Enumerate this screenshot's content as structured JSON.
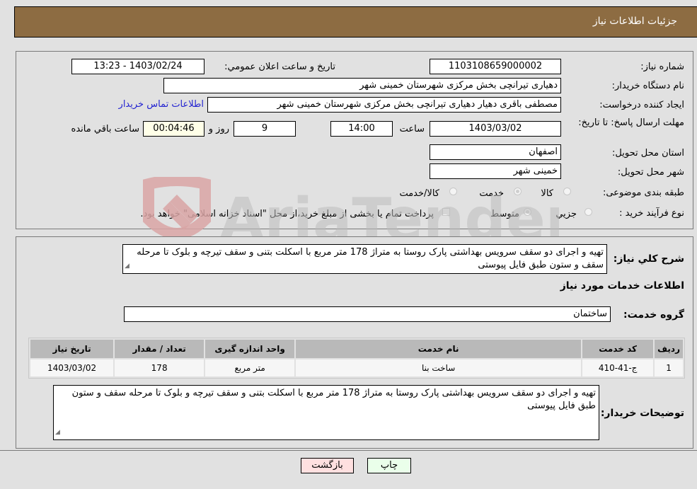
{
  "header": {
    "title": "جزئیات اطلاعات نیاز"
  },
  "fields": {
    "need_number_label": "شماره نیاز:",
    "need_number": "1103108659000002",
    "announce_label": "تاریخ و ساعت اعلان عمومي:",
    "announce_value": "1403/02/24 - 13:23",
    "buyer_org_label": "نام دستگاه خریدار:",
    "buyer_org": "دهیاری تیرانچی بخش مرکزی شهرستان خمینی شهر",
    "creator_label": "ایجاد کننده درخواست:",
    "creator": "مصطفی باقری دهیار  دهیاری تیرانچی بخش مرکزی شهرستان خمینی شهر",
    "contact_link": "اطلاعات تماس خریدار",
    "deadline_label": "مهلت ارسال پاسخ: تا تاریخ:",
    "deadline_date": "1403/03/02",
    "time_label": "ساعت",
    "deadline_time": "14:00",
    "days_value": "9",
    "days_label": "روز و",
    "remaining_time": "00:04:46",
    "remaining_label": "ساعت باقي مانده",
    "province_label": "استان محل تحویل:",
    "province": "اصفهان",
    "city_label": "شهر محل تحویل:",
    "city": "خمینی شهر",
    "category_label": "طبقه بندی موضوعی:",
    "category_options": [
      {
        "label": "کالا",
        "checked": false
      },
      {
        "label": "خدمت",
        "checked": true
      },
      {
        "label": "کالا/خدمت",
        "checked": false
      }
    ],
    "process_label": "نوع فرآیند خرید :",
    "process_options": [
      {
        "label": "جزيي",
        "checked": false
      },
      {
        "label": "متوسط",
        "checked": true
      }
    ],
    "treasury_note": "پرداخت تمام یا بخشی از مبلغ خرید،از محل \"اسناد خزانه اسلامی\" خواهد بود."
  },
  "description": {
    "label": "شرح کلي نیاز:",
    "text": "تهیه و اجرای دو سقف سرویس بهداشتی پارک روستا به متراژ 178 متر مربع با اسکلت بتنی و سقف تیرچه و بلوک تا مرحله سقف و ستون طبق فایل پیوستی"
  },
  "services": {
    "section_title": "اطلاعات خدمات مورد نیاز",
    "group_label": "گروه خدمت:",
    "group_value": "ساختمان",
    "columns": [
      "ردیف",
      "کد خدمت",
      "نام خدمت",
      "واحد اندازه گیری",
      "تعداد / مقدار",
      "تاریخ نیاز"
    ],
    "rows": [
      [
        "1",
        "ج-41-410",
        "ساخت بنا",
        "متر مربع",
        "178",
        "1403/03/02"
      ]
    ]
  },
  "buyer_notes": {
    "label": "توضیحات خریدار:",
    "text": "تهیه و اجرای دو سقف سرویس بهداشتی پارک روستا به متراژ 178 متر مربع با اسکلت بتنی و سقف تیرچه و بلوک تا مرحله سقف و ستون طبق فایل پیوستی"
  },
  "buttons": {
    "print": "چاپ",
    "back": "بازگشت"
  },
  "watermark": {
    "text": "AriaTender.neT"
  }
}
